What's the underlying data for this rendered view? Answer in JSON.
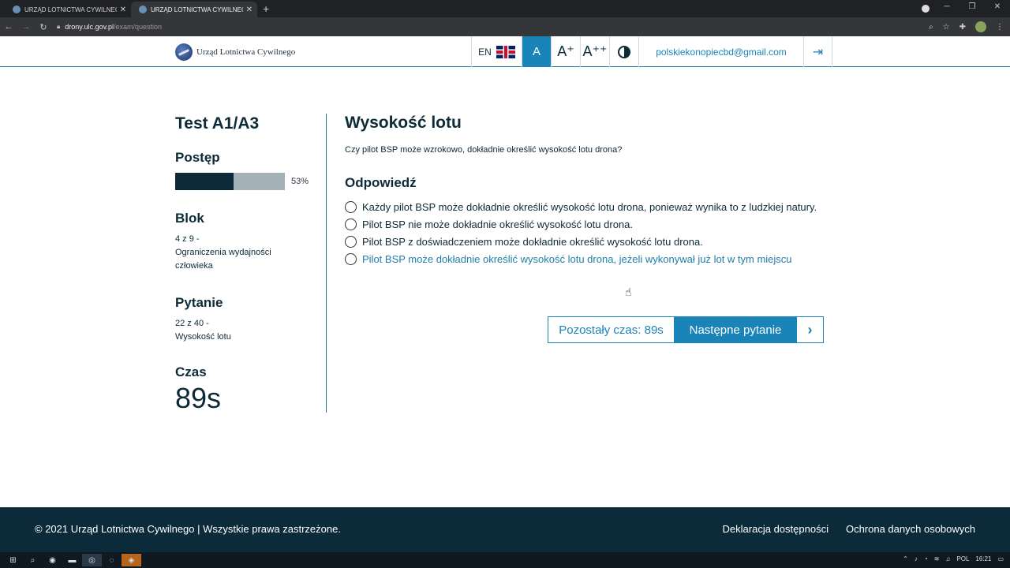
{
  "browser": {
    "tabs": [
      {
        "title": "URZĄD LOTNICTWA CYWILNEGO",
        "active": false
      },
      {
        "title": "URZĄD LOTNICTWA CYWILNEGO",
        "active": true
      }
    ],
    "new_tab": "+",
    "url_host": "drony.ulc.gov.pl",
    "url_path": "/exam/question"
  },
  "header": {
    "logo_text": "Urząd Lotnictwa Cywilnego",
    "lang": "EN",
    "font_a": "A",
    "font_a_plus": "A⁺",
    "font_a_plusplus": "A⁺⁺",
    "email": "polskiekonopiecbd@gmail.com"
  },
  "left": {
    "test_title": "Test A1/A3",
    "progress_label": "Postęp",
    "progress_percent": "53%",
    "progress_value": 0.53,
    "block_label": "Blok",
    "block_number": "4 z 9 -",
    "block_name": "Ograniczenia wydajności człowieka",
    "question_label": "Pytanie",
    "question_number": "22 z 40 -",
    "question_name": "Wysokość lotu",
    "time_label": "Czas",
    "time_value": "89s"
  },
  "question": {
    "title": "Wysokość lotu",
    "text": "Czy pilot BSP może wzrokowo, dokładnie określić wysokość lotu drona?",
    "answers_label": "Odpowiedź",
    "answers": [
      "Każdy pilot BSP może dokładnie określić wysokość lotu drona, ponieważ wynika to z ludzkiej natury.",
      "Pilot BSP nie może dokładnie określić wysokość lotu drona.",
      "Pilot BSP z doświadczeniem może dokładnie określić wysokość lotu drona.",
      "Pilot BSP może dokładnie określić wysokość lotu drona, jeżeli wykonywał już lot w tym miejscu"
    ],
    "remaining_time": "Pozostały czas: 89s",
    "next_label": "Następne pytanie"
  },
  "footer": {
    "copyright": "© 2021 Urząd Lotnictwa Cywilnego | Wszystkie prawa zastrzeżone.",
    "link_accessibility": "Deklaracja dostępności",
    "link_privacy": "Ochrona danych osobowych"
  },
  "taskbar": {
    "lang": "POL",
    "time": "16:21"
  },
  "colors": {
    "accent": "#1a84b8",
    "dark": "#0d2a38",
    "footer_bg": "#0c2b3a"
  }
}
